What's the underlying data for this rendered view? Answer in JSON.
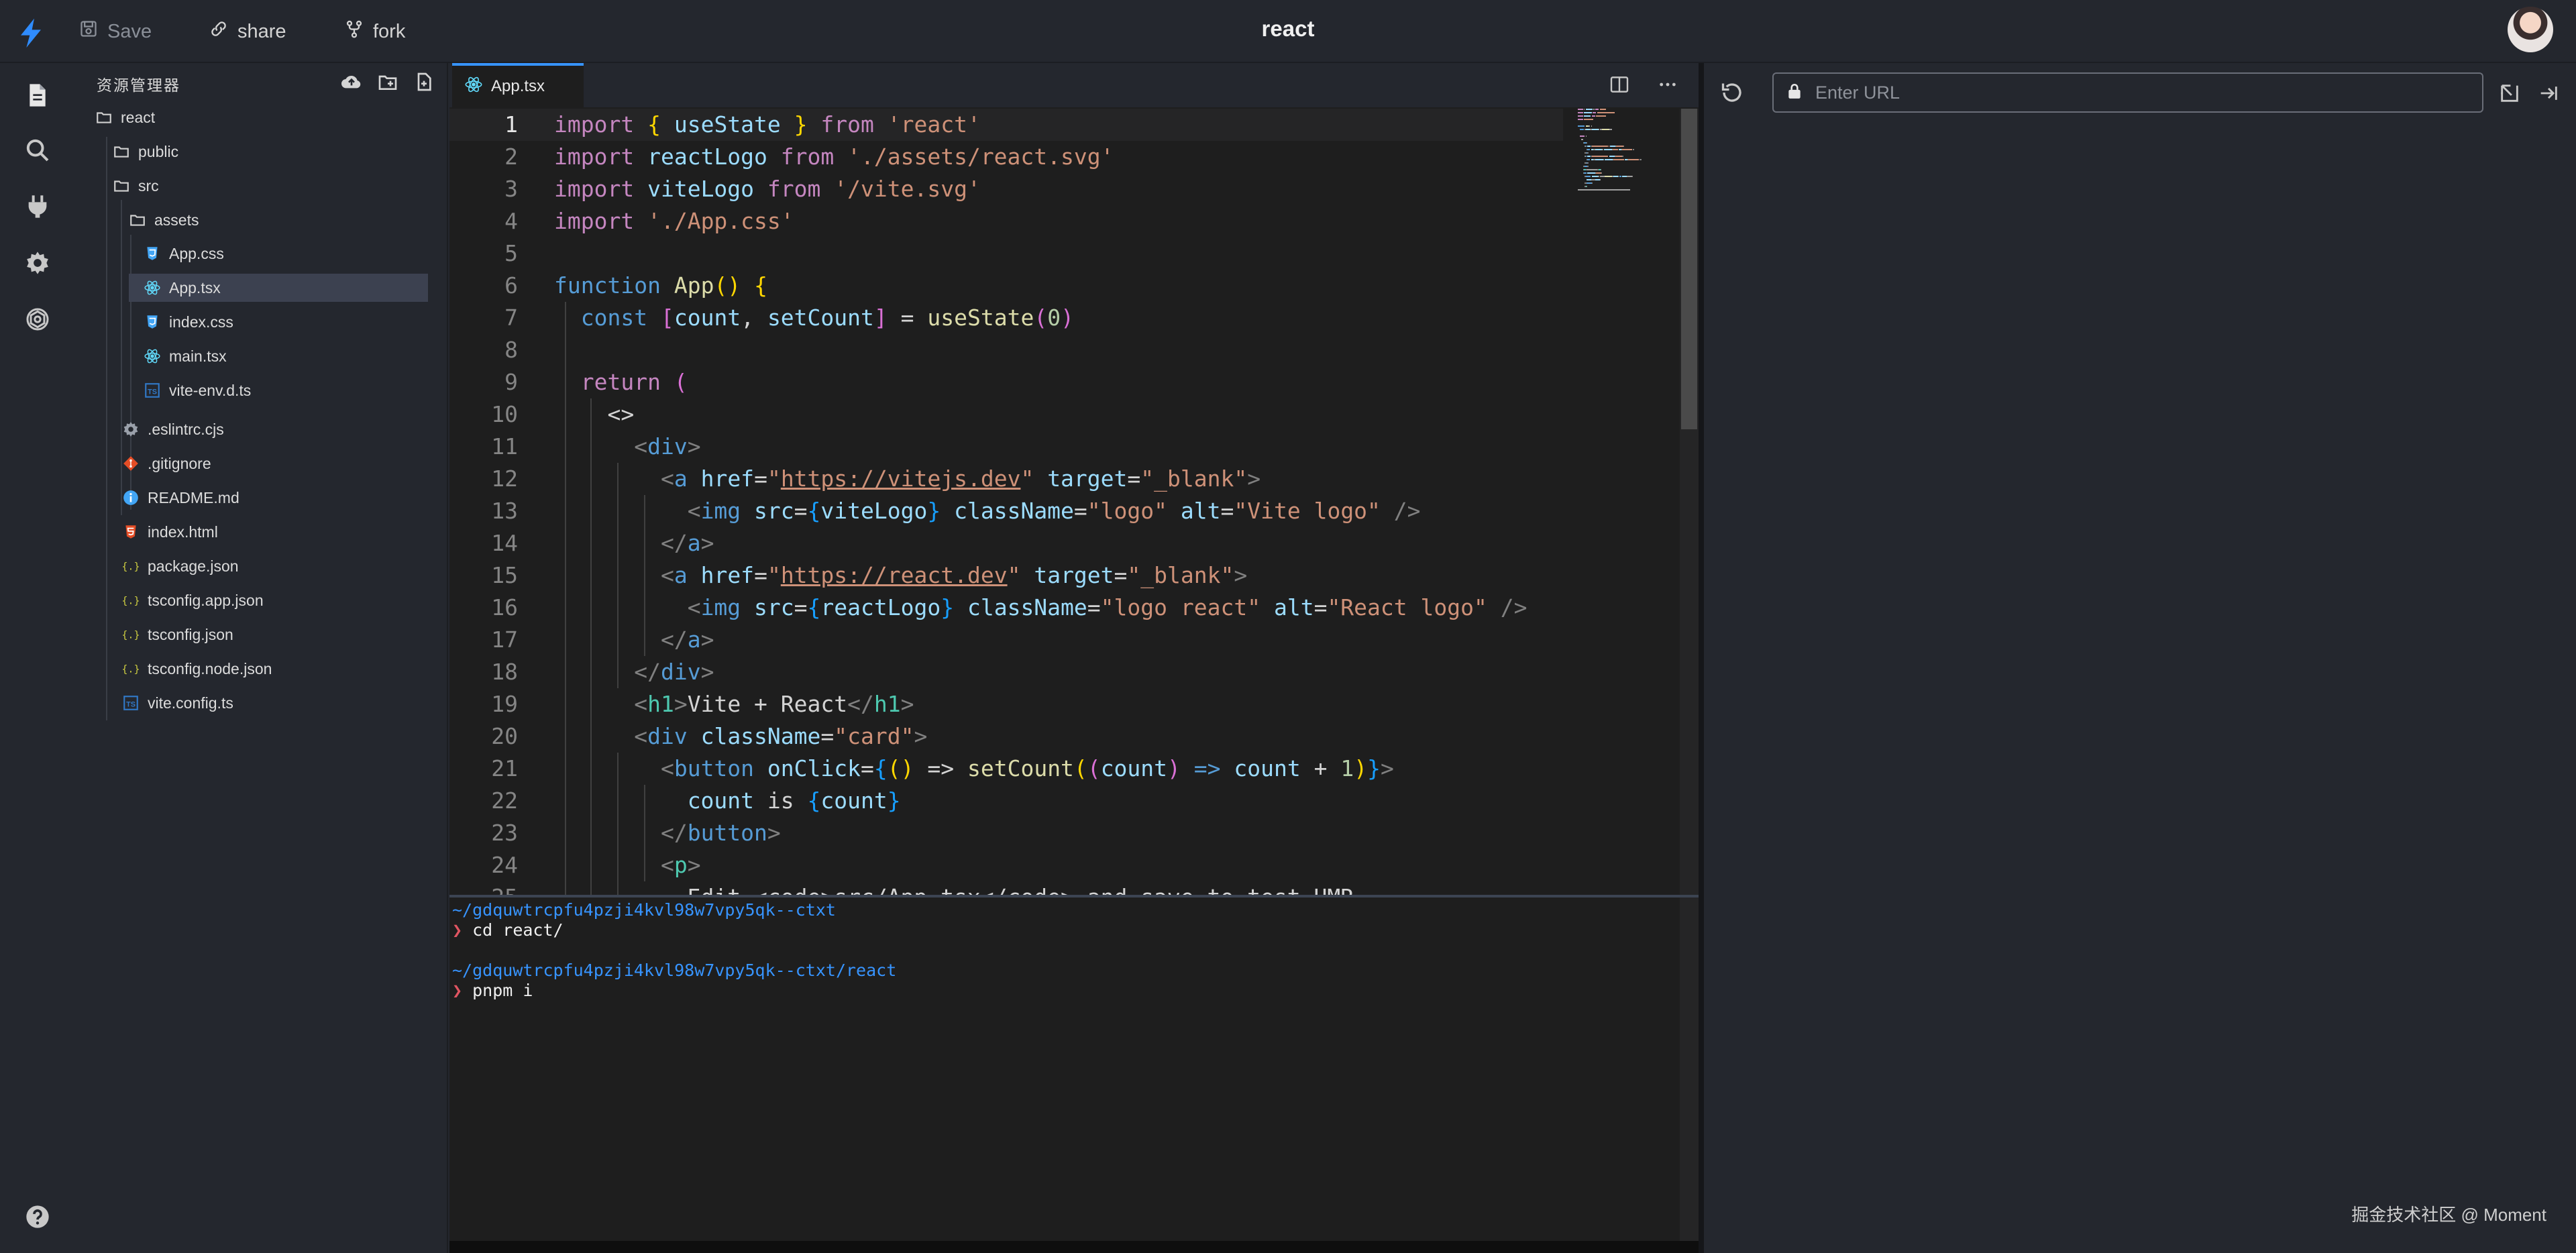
{
  "topbar": {
    "save_label": "Save",
    "share_label": "share",
    "fork_label": "fork",
    "title": "react"
  },
  "explorer": {
    "title": "资源管理器",
    "tree": [
      {
        "label": "react",
        "icon": "folder-icon",
        "depth": 0
      },
      {
        "label": "public",
        "icon": "folder-icon",
        "depth": 1
      },
      {
        "label": "src",
        "icon": "folder-icon",
        "depth": 1
      },
      {
        "label": "assets",
        "icon": "folder-icon",
        "depth": 2
      },
      {
        "label": "App.css",
        "icon": "css-file-icon",
        "depth": 3
      },
      {
        "label": "App.tsx",
        "icon": "react-file-icon",
        "depth": 3,
        "selected": true
      },
      {
        "label": "index.css",
        "icon": "css-file-icon",
        "depth": 3
      },
      {
        "label": "main.tsx",
        "icon": "react-file-icon",
        "depth": 3
      },
      {
        "label": "vite-env.d.ts",
        "icon": "ts-file-icon",
        "depth": 3
      },
      {
        "label": ".eslintrc.cjs",
        "icon": "gear-file-icon",
        "depth": 2
      },
      {
        "label": ".gitignore",
        "icon": "git-file-icon",
        "depth": 2
      },
      {
        "label": "README.md",
        "icon": "info-file-icon",
        "depth": 2
      },
      {
        "label": "index.html",
        "icon": "html-file-icon",
        "depth": 2
      },
      {
        "label": "package.json",
        "icon": "json-file-icon",
        "depth": 2
      },
      {
        "label": "tsconfig.app.json",
        "icon": "json-file-icon",
        "depth": 2
      },
      {
        "label": "tsconfig.json",
        "icon": "json-file-icon",
        "depth": 2
      },
      {
        "label": "tsconfig.node.json",
        "icon": "json-file-icon",
        "depth": 2
      },
      {
        "label": "vite.config.ts",
        "icon": "ts-file-icon",
        "depth": 2
      }
    ]
  },
  "editor": {
    "tab_label": "App.tsx",
    "current_line": 1,
    "lines": [
      [
        [
          "kw",
          "import"
        ],
        [
          "p",
          " "
        ],
        [
          "b1",
          "{"
        ],
        [
          "p",
          " "
        ],
        [
          "var",
          "useState"
        ],
        [
          "p",
          " "
        ],
        [
          "b1",
          "}"
        ],
        [
          "p",
          " "
        ],
        [
          "kw",
          "from"
        ],
        [
          "p",
          " "
        ],
        [
          "str",
          "'react'"
        ]
      ],
      [
        [
          "kw",
          "import"
        ],
        [
          "p",
          " "
        ],
        [
          "var",
          "reactLogo"
        ],
        [
          "p",
          " "
        ],
        [
          "kw",
          "from"
        ],
        [
          "p",
          " "
        ],
        [
          "str",
          "'./assets/react.svg'"
        ]
      ],
      [
        [
          "kw",
          "import"
        ],
        [
          "p",
          " "
        ],
        [
          "var",
          "viteLogo"
        ],
        [
          "p",
          " "
        ],
        [
          "kw",
          "from"
        ],
        [
          "p",
          " "
        ],
        [
          "str",
          "'/vite.svg'"
        ]
      ],
      [
        [
          "kw",
          "import"
        ],
        [
          "p",
          " "
        ],
        [
          "str",
          "'./App.css'"
        ]
      ],
      [],
      [
        [
          "kw2",
          "function"
        ],
        [
          "p",
          " "
        ],
        [
          "fn",
          "App"
        ],
        [
          "b1",
          "()"
        ],
        [
          "p",
          " "
        ],
        [
          "b1",
          "{"
        ]
      ],
      [
        [
          "p",
          "  "
        ],
        [
          "kw2",
          "const"
        ],
        [
          "p",
          " "
        ],
        [
          "b2",
          "["
        ],
        [
          "var",
          "count"
        ],
        [
          "p",
          ", "
        ],
        [
          "var",
          "setCount"
        ],
        [
          "b2",
          "]"
        ],
        [
          "p",
          " = "
        ],
        [
          "fn",
          "useState"
        ],
        [
          "b2",
          "("
        ],
        [
          "num",
          "0"
        ],
        [
          "b2",
          ")"
        ]
      ],
      [],
      [
        [
          "p",
          "  "
        ],
        [
          "kw",
          "return"
        ],
        [
          "p",
          " "
        ],
        [
          "b2",
          "("
        ]
      ],
      [
        [
          "p",
          "    "
        ],
        [
          "p",
          "<>"
        ]
      ],
      [
        [
          "p",
          "      "
        ],
        [
          "gray",
          "<"
        ],
        [
          "tag",
          "div"
        ],
        [
          "gray",
          ">"
        ]
      ],
      [
        [
          "p",
          "        "
        ],
        [
          "gray",
          "<"
        ],
        [
          "tag",
          "a"
        ],
        [
          "p",
          " "
        ],
        [
          "attr",
          "href"
        ],
        [
          "p",
          "="
        ],
        [
          "str",
          "\""
        ],
        [
          "link",
          "https://vitejs.dev"
        ],
        [
          "str",
          "\""
        ],
        [
          "p",
          " "
        ],
        [
          "attr",
          "target"
        ],
        [
          "p",
          "="
        ],
        [
          "str",
          "\"_blank\""
        ],
        [
          "gray",
          ">"
        ]
      ],
      [
        [
          "p",
          "          "
        ],
        [
          "gray",
          "<"
        ],
        [
          "tag",
          "img"
        ],
        [
          "p",
          " "
        ],
        [
          "attr",
          "src"
        ],
        [
          "p",
          "="
        ],
        [
          "b3",
          "{"
        ],
        [
          "var",
          "viteLogo"
        ],
        [
          "b3",
          "}"
        ],
        [
          "p",
          " "
        ],
        [
          "attr",
          "className"
        ],
        [
          "p",
          "="
        ],
        [
          "str",
          "\"logo\""
        ],
        [
          "p",
          " "
        ],
        [
          "attr",
          "alt"
        ],
        [
          "p",
          "="
        ],
        [
          "str",
          "\"Vite logo\""
        ],
        [
          "p",
          " "
        ],
        [
          "gray",
          "/>"
        ]
      ],
      [
        [
          "p",
          "        "
        ],
        [
          "gray",
          "</"
        ],
        [
          "tag",
          "a"
        ],
        [
          "gray",
          ">"
        ]
      ],
      [
        [
          "p",
          "        "
        ],
        [
          "gray",
          "<"
        ],
        [
          "tag",
          "a"
        ],
        [
          "p",
          " "
        ],
        [
          "attr",
          "href"
        ],
        [
          "p",
          "="
        ],
        [
          "str",
          "\""
        ],
        [
          "link",
          "https://react.dev"
        ],
        [
          "str",
          "\""
        ],
        [
          "p",
          " "
        ],
        [
          "attr",
          "target"
        ],
        [
          "p",
          "="
        ],
        [
          "str",
          "\"_blank\""
        ],
        [
          "gray",
          ">"
        ]
      ],
      [
        [
          "p",
          "          "
        ],
        [
          "gray",
          "<"
        ],
        [
          "tag",
          "img"
        ],
        [
          "p",
          " "
        ],
        [
          "attr",
          "src"
        ],
        [
          "p",
          "="
        ],
        [
          "b3",
          "{"
        ],
        [
          "var",
          "reactLogo"
        ],
        [
          "b3",
          "}"
        ],
        [
          "p",
          " "
        ],
        [
          "attr",
          "className"
        ],
        [
          "p",
          "="
        ],
        [
          "str",
          "\"logo react\""
        ],
        [
          "p",
          " "
        ],
        [
          "attr",
          "alt"
        ],
        [
          "p",
          "="
        ],
        [
          "str",
          "\"React logo\""
        ],
        [
          "p",
          " "
        ],
        [
          "gray",
          "/>"
        ]
      ],
      [
        [
          "p",
          "        "
        ],
        [
          "gray",
          "</"
        ],
        [
          "tag",
          "a"
        ],
        [
          "gray",
          ">"
        ]
      ],
      [
        [
          "p",
          "      "
        ],
        [
          "gray",
          "</"
        ],
        [
          "tag",
          "div"
        ],
        [
          "gray",
          ">"
        ]
      ],
      [
        [
          "p",
          "      "
        ],
        [
          "gray",
          "<"
        ],
        [
          "tagn",
          "h1"
        ],
        [
          "gray",
          ">"
        ],
        [
          "p",
          "Vite + React"
        ],
        [
          "gray",
          "</"
        ],
        [
          "tagn",
          "h1"
        ],
        [
          "gray",
          ">"
        ]
      ],
      [
        [
          "p",
          "      "
        ],
        [
          "gray",
          "<"
        ],
        [
          "tag",
          "div"
        ],
        [
          "p",
          " "
        ],
        [
          "attr",
          "className"
        ],
        [
          "p",
          "="
        ],
        [
          "str",
          "\"card\""
        ],
        [
          "gray",
          ">"
        ]
      ],
      [
        [
          "p",
          "        "
        ],
        [
          "gray",
          "<"
        ],
        [
          "tag",
          "button"
        ],
        [
          "p",
          " "
        ],
        [
          "attr",
          "onClick"
        ],
        [
          "p",
          "="
        ],
        [
          "b3",
          "{"
        ],
        [
          "b1",
          "()"
        ],
        [
          "p",
          " => "
        ],
        [
          "fn",
          "setCount"
        ],
        [
          "b1",
          "("
        ],
        [
          "b2",
          "("
        ],
        [
          "var",
          "count"
        ],
        [
          "b2",
          ")"
        ],
        [
          "p",
          " "
        ],
        [
          "kw2",
          "=>"
        ],
        [
          "p",
          " "
        ],
        [
          "var",
          "count"
        ],
        [
          "p",
          " + "
        ],
        [
          "num",
          "1"
        ],
        [
          "b1",
          ")"
        ],
        [
          "b3",
          "}"
        ],
        [
          "gray",
          ">"
        ]
      ],
      [
        [
          "p",
          "          "
        ],
        [
          "var",
          "count"
        ],
        [
          "p",
          " is "
        ],
        [
          "b3",
          "{"
        ],
        [
          "var",
          "count"
        ],
        [
          "b3",
          "}"
        ]
      ],
      [
        [
          "p",
          "        "
        ],
        [
          "gray",
          "</"
        ],
        [
          "tag",
          "button"
        ],
        [
          "gray",
          ">"
        ]
      ],
      [
        [
          "p",
          "        "
        ],
        [
          "gray",
          "<"
        ],
        [
          "tagn",
          "p"
        ],
        [
          "gray",
          ">"
        ]
      ],
      [
        [
          "p",
          "          Edit "
        ],
        [
          "p",
          "<code>src/App.tsx</code> and save to test HMR"
        ]
      ]
    ]
  },
  "terminal": {
    "lines": [
      {
        "type": "path",
        "text": "~/gdquwtrcpfu4pzji4kvl98w7vpy5qk--ctxt"
      },
      {
        "type": "cmd",
        "prompt": "❯",
        "text": " cd react/"
      },
      {
        "type": "blank",
        "text": ""
      },
      {
        "type": "path",
        "text": "~/gdquwtrcpfu4pzji4kvl98w7vpy5qk--ctxt/react"
      },
      {
        "type": "cmd",
        "prompt": "❯",
        "text": " pnpm i"
      }
    ]
  },
  "preview": {
    "url_placeholder": "Enter URL",
    "url_value": "",
    "watermark": "掘金技术社区 @ Moment"
  },
  "colors": {
    "accent": "#3794ff",
    "selected_bg": "#3c4150",
    "terminal_prompt": "#e05561"
  }
}
